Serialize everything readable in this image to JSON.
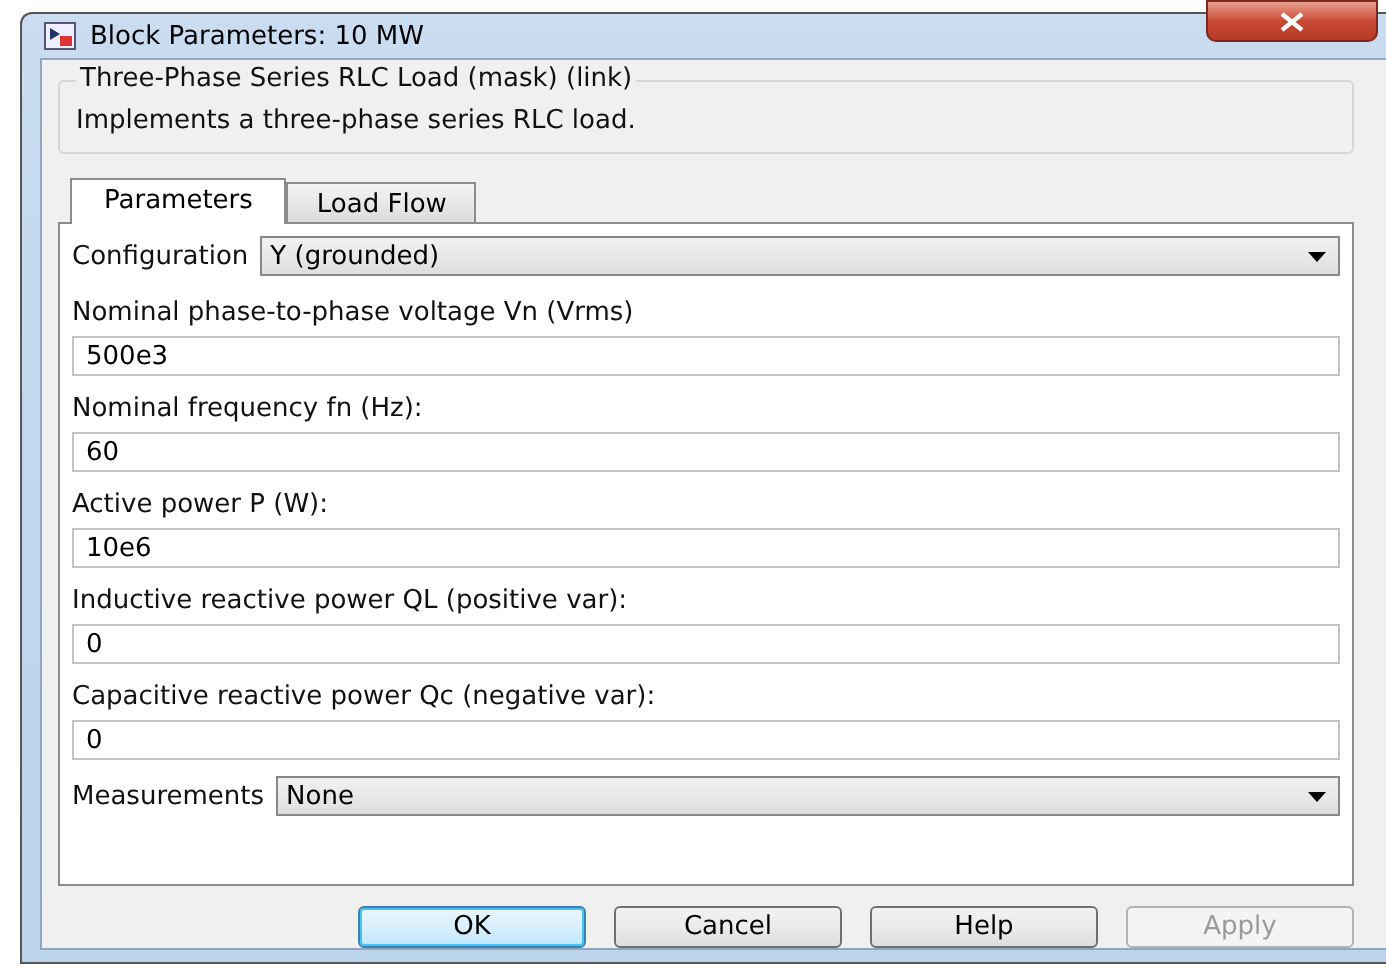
{
  "window": {
    "title": "Block Parameters: 10 MW"
  },
  "group": {
    "title": "Three-Phase Series RLC Load (mask) (link)",
    "description": "Implements a three-phase series RLC load."
  },
  "tabs": [
    {
      "label": "Parameters",
      "selected": true
    },
    {
      "label": "Load Flow",
      "selected": false
    }
  ],
  "parameters": [
    {
      "kind": "dropdown",
      "label": "Configuration",
      "value": "Y (grounded)"
    },
    {
      "kind": "field",
      "label": "Nominal phase-to-phase voltage Vn (Vrms)",
      "value": "500e3"
    },
    {
      "kind": "field",
      "label": "Nominal frequency fn (Hz):",
      "value": "60"
    },
    {
      "kind": "field",
      "label": "Active power P (W):",
      "value": "10e6"
    },
    {
      "kind": "field",
      "label": "Inductive reactive power QL (positive var):",
      "value": "0"
    },
    {
      "kind": "field",
      "label": "Capacitive reactive power Qc (negative var):",
      "value": "0"
    },
    {
      "kind": "dropdown",
      "label": "Measurements",
      "value": "None"
    }
  ],
  "buttons": [
    {
      "label": "OK",
      "focused": true,
      "disabled": false
    },
    {
      "label": "Cancel",
      "focused": false,
      "disabled": false
    },
    {
      "label": "Help",
      "focused": false,
      "disabled": false
    },
    {
      "label": "Apply",
      "focused": false,
      "disabled": true
    }
  ]
}
